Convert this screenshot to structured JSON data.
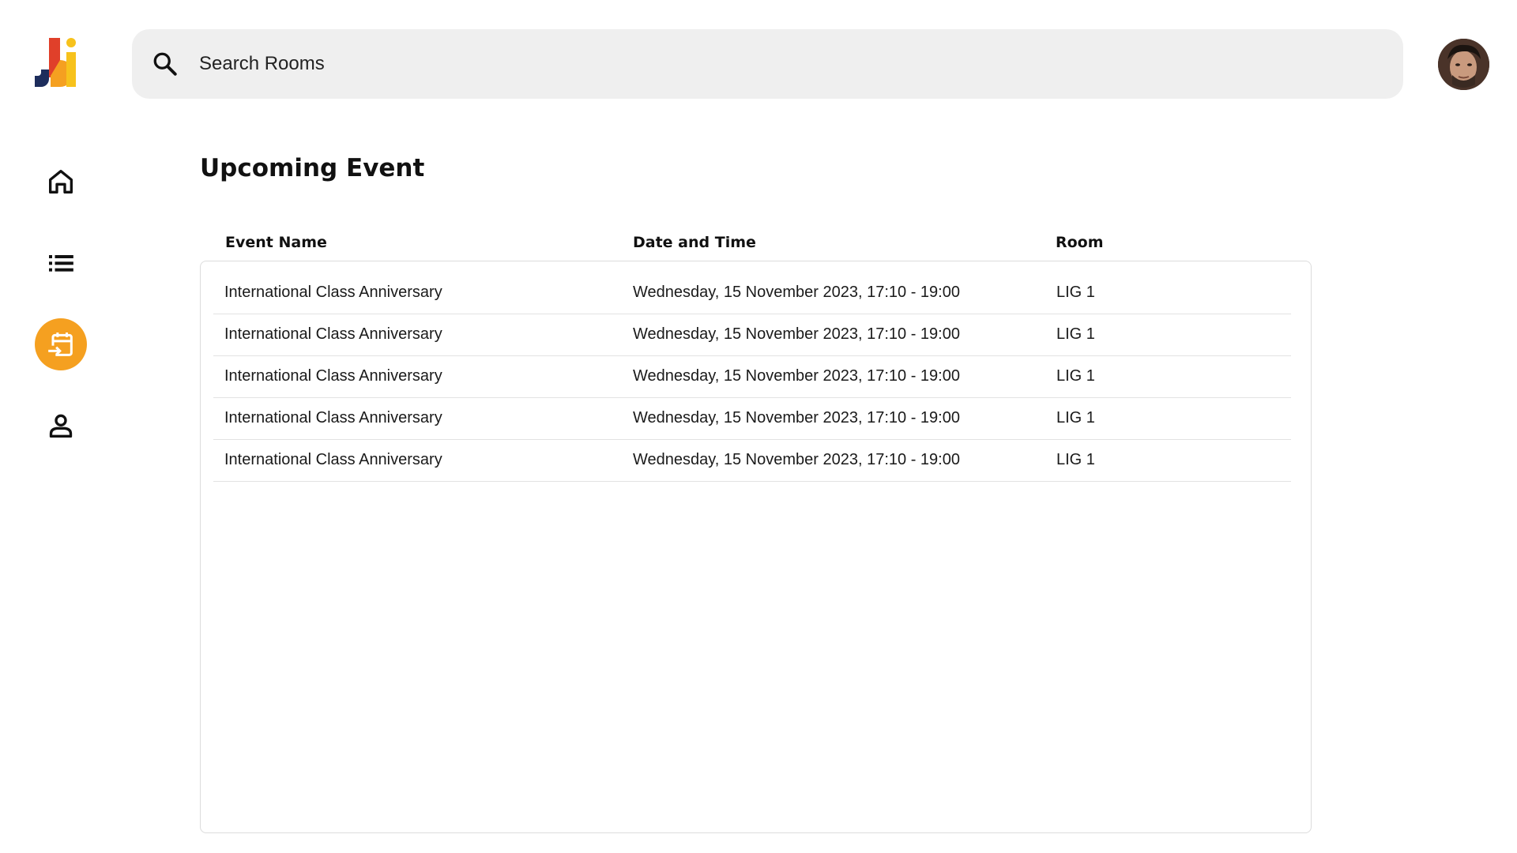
{
  "app": {
    "logo_text": "Ji",
    "brand_colors": {
      "orange": "#f5a020",
      "red": "#e0402a",
      "navy": "#1d2d5c",
      "yellow": "#f7c21c"
    }
  },
  "search": {
    "placeholder": "Search Rooms",
    "icon": "search-icon"
  },
  "user": {
    "avatar_icon": "user-avatar"
  },
  "sidebar": {
    "items": [
      {
        "name": "home",
        "icon": "home-icon",
        "active": false
      },
      {
        "name": "list",
        "icon": "list-icon",
        "active": false
      },
      {
        "name": "calendar-checkin",
        "icon": "calendar-enter-icon",
        "active": true
      },
      {
        "name": "profile",
        "icon": "person-icon",
        "active": false
      }
    ],
    "accent_color": "#f5a020"
  },
  "main": {
    "title": "Upcoming Event",
    "table": {
      "columns": [
        "Event Name",
        "Date and Time",
        "Room"
      ],
      "rows": [
        [
          "International Class Anniversary",
          "Wednesday, 15 November 2023, 17:10 - 19:00",
          "LIG 1"
        ],
        [
          "International Class Anniversary",
          "Wednesday, 15 November 2023, 17:10 - 19:00",
          "LIG 1"
        ],
        [
          "International Class Anniversary",
          "Wednesday, 15 November 2023, 17:10 - 19:00",
          "LIG 1"
        ],
        [
          "International Class Anniversary",
          "Wednesday, 15 November 2023, 17:10 - 19:00",
          "LIG 1"
        ],
        [
          "International Class Anniversary",
          "Wednesday, 15 November 2023, 17:10 - 19:00",
          "LIG 1"
        ]
      ]
    }
  }
}
